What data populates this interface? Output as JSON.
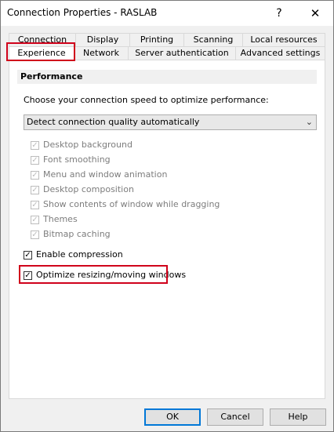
{
  "window": {
    "title": "Connection Properties - RASLAB",
    "help_glyph": "?",
    "close_glyph": "✕"
  },
  "tabs": {
    "row1": [
      "Connection",
      "Display",
      "Printing",
      "Scanning",
      "Local resources"
    ],
    "row2": [
      "Experience",
      "Network",
      "Server authentication",
      "Advanced settings"
    ],
    "active": "Experience"
  },
  "performance": {
    "header": "Performance",
    "prompt": "Choose your connection speed to optimize performance:",
    "speed_select_value": "Detect connection quality automatically",
    "options": [
      {
        "label": "Desktop background",
        "checked": true,
        "disabled": true
      },
      {
        "label": "Font smoothing",
        "checked": true,
        "disabled": true
      },
      {
        "label": "Menu and window animation",
        "checked": true,
        "disabled": true
      },
      {
        "label": "Desktop composition",
        "checked": true,
        "disabled": true
      },
      {
        "label": "Show contents of window while dragging",
        "checked": true,
        "disabled": true
      },
      {
        "label": "Themes",
        "checked": true,
        "disabled": true
      },
      {
        "label": "Bitmap caching",
        "checked": true,
        "disabled": true
      }
    ],
    "enable_compression": {
      "label": "Enable compression",
      "checked": true
    },
    "optimize_resizing": {
      "label": "Optimize resizing/moving windows",
      "checked": true
    }
  },
  "buttons": {
    "ok": "OK",
    "cancel": "Cancel",
    "help": "Help"
  },
  "colors": {
    "highlight_box": "#d0021b",
    "default_button_border": "#0078d7"
  }
}
